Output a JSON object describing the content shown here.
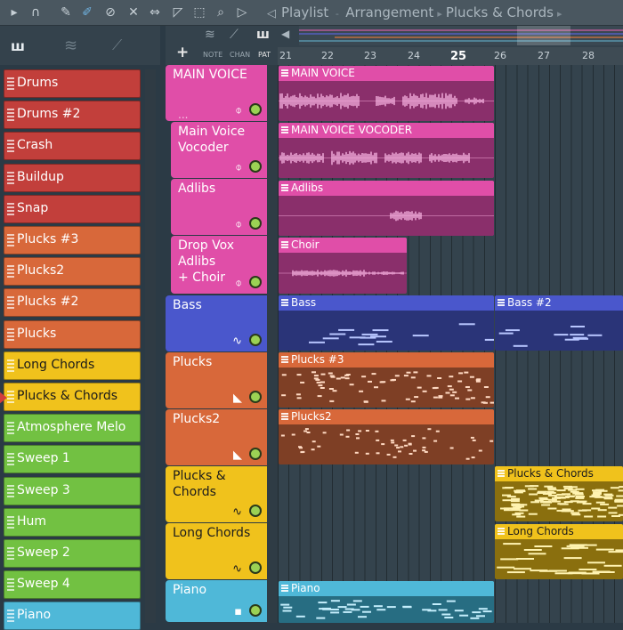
{
  "toolbar": {
    "title_prefix": "Playlist",
    "title_mode": "Arrangement",
    "title_pattern": "Plucks & Chords",
    "icons": [
      "magnet-icon",
      "brush-icon",
      "paint-icon",
      "mute-icon",
      "speaker-mute-icon",
      "slip-icon",
      "select-icon",
      "zoom-icon",
      "play-icon"
    ]
  },
  "browser": {
    "channels": [
      {
        "label": "Drums",
        "color": "#c23f3b"
      },
      {
        "label": "Drums #2",
        "color": "#c23f3b"
      },
      {
        "label": "Crash",
        "color": "#c23f3b"
      },
      {
        "label": "Buildup",
        "color": "#c23f3b"
      },
      {
        "label": "Snap",
        "color": "#c23f3b"
      },
      {
        "label": "Plucks #3",
        "color": "#d8683a"
      },
      {
        "label": "Plucks2",
        "color": "#d8683a"
      },
      {
        "label": "Plucks #2",
        "color": "#d8683a"
      },
      {
        "label": "Plucks",
        "color": "#d8683a"
      },
      {
        "label": "Long Chords",
        "color": "#f0c21c"
      },
      {
        "label": "Plucks & Chords",
        "color": "#f0c21c"
      },
      {
        "label": "Atmosphere Melo",
        "color": "#72c142"
      },
      {
        "label": "Sweep 1",
        "color": "#72c142"
      },
      {
        "label": "Sweep 3",
        "color": "#72c142"
      },
      {
        "label": "Hum",
        "color": "#72c142"
      },
      {
        "label": "Sweep 2",
        "color": "#72c142"
      },
      {
        "label": "Sweep 4",
        "color": "#72c142"
      },
      {
        "label": "Piano",
        "color": "#4fb8d8"
      }
    ]
  },
  "timeline": {
    "mini_labels": {
      "note": "NOTE",
      "chan": "CHAN",
      "pat": "PAT"
    },
    "ruler": [
      "21",
      "22",
      "23",
      "24",
      "25",
      "26",
      "27",
      "28"
    ]
  },
  "tracks": [
    {
      "name": "MAIN VOICE",
      "color": "#e04ea8"
    },
    {
      "name": "Main Voice\nVocoder",
      "color": "#e04ea8"
    },
    {
      "name": "Adlibs",
      "color": "#e04ea8"
    },
    {
      "name": "Drop Vox Adlibs\n+ Choir",
      "color": "#e04ea8"
    },
    {
      "name": "Bass",
      "color": "#4a57cc"
    },
    {
      "name": "Plucks",
      "color": "#d8683a"
    },
    {
      "name": "Plucks2",
      "color": "#d8683a"
    },
    {
      "name": "Plucks & Chords",
      "color": "#f0c21c"
    },
    {
      "name": "Long Chords",
      "color": "#f0c21c"
    },
    {
      "name": "Piano",
      "color": "#4fb8d8"
    }
  ],
  "clips": [
    {
      "label": "MAIN VOICE",
      "kind": "audio",
      "color": "#e04ea8",
      "body": "#8a2f6b"
    },
    {
      "label": "MAIN VOICE VOCODER",
      "kind": "audio",
      "color": "#e04ea8",
      "body": "#8a2f6b"
    },
    {
      "label": "Adlibs",
      "kind": "audio",
      "color": "#e04ea8",
      "body": "#8a2f6b"
    },
    {
      "label": "Choir",
      "kind": "audio",
      "color": "#e04ea8",
      "body": "#8a2f6b"
    },
    {
      "label": "Bass",
      "kind": "pattern",
      "color": "#4a57cc",
      "body": "#2a3478"
    },
    {
      "label": "Bass #2",
      "kind": "pattern",
      "color": "#4a57cc",
      "body": "#2a3478"
    },
    {
      "label": "Plucks #3",
      "kind": "pattern",
      "color": "#d8683a",
      "body": "#7e3f25"
    },
    {
      "label": "Plucks2",
      "kind": "pattern",
      "color": "#d8683a",
      "body": "#7e3f25"
    },
    {
      "label": "Plucks & Chords",
      "kind": "pattern",
      "color": "#f0c21c",
      "body": "#8a6f0e"
    },
    {
      "label": "Long Chords",
      "kind": "pattern",
      "color": "#f0c21c",
      "body": "#8a6f0e"
    },
    {
      "label": "Piano",
      "kind": "pattern",
      "color": "#4fb8d8",
      "body": "#276d82"
    }
  ]
}
